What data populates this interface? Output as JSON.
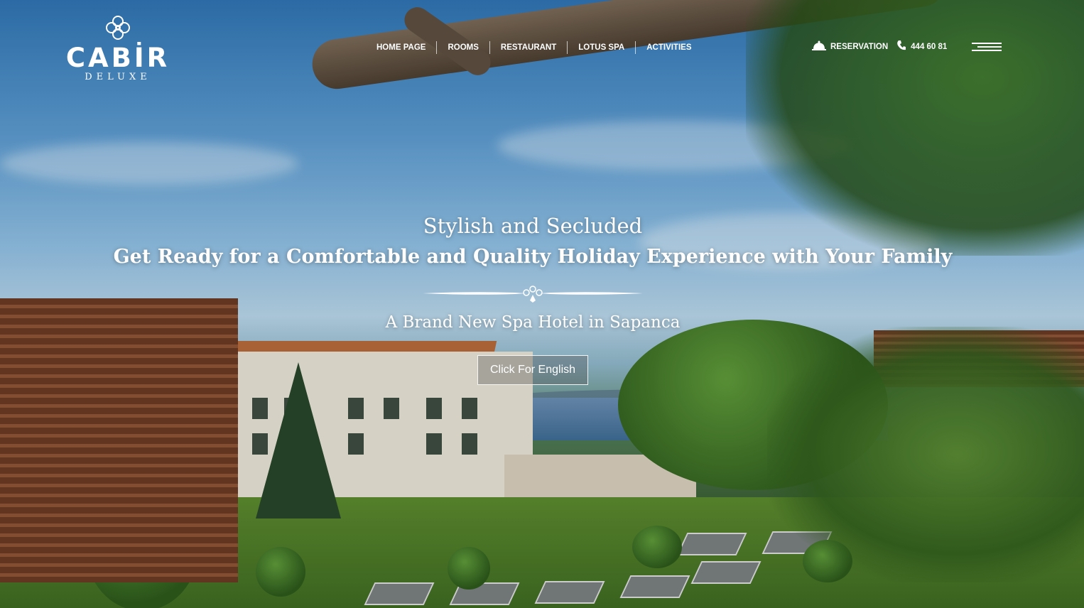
{
  "brand": {
    "name": "CABİR",
    "subtitle": "DELUXE",
    "logo_icon": "flower-emblem-icon"
  },
  "nav": {
    "items": [
      {
        "label": "HOME PAGE"
      },
      {
        "label": "ROOMS"
      },
      {
        "label": "RESTAURANT"
      },
      {
        "label": "LOTUS SPA"
      },
      {
        "label": "ACTIVITIES"
      }
    ]
  },
  "actions": {
    "reservation_label": "RESERVATION",
    "reservation_icon": "bell-icon",
    "phone_label": "444 60 81",
    "phone_icon": "phone-icon",
    "menu_icon": "hamburger-menu-icon"
  },
  "hero": {
    "eyebrow": "Stylish and Secluded",
    "headline": "Get Ready for a Comfortable and Quality Holiday Experience with Your Family",
    "tagline": "A Brand New Spa Hotel in Sapanca",
    "cta_label": "Click For English",
    "divider_icon": "ornament-divider-icon"
  },
  "colors": {
    "text": "#ffffff",
    "button_border": "#ffffff"
  }
}
